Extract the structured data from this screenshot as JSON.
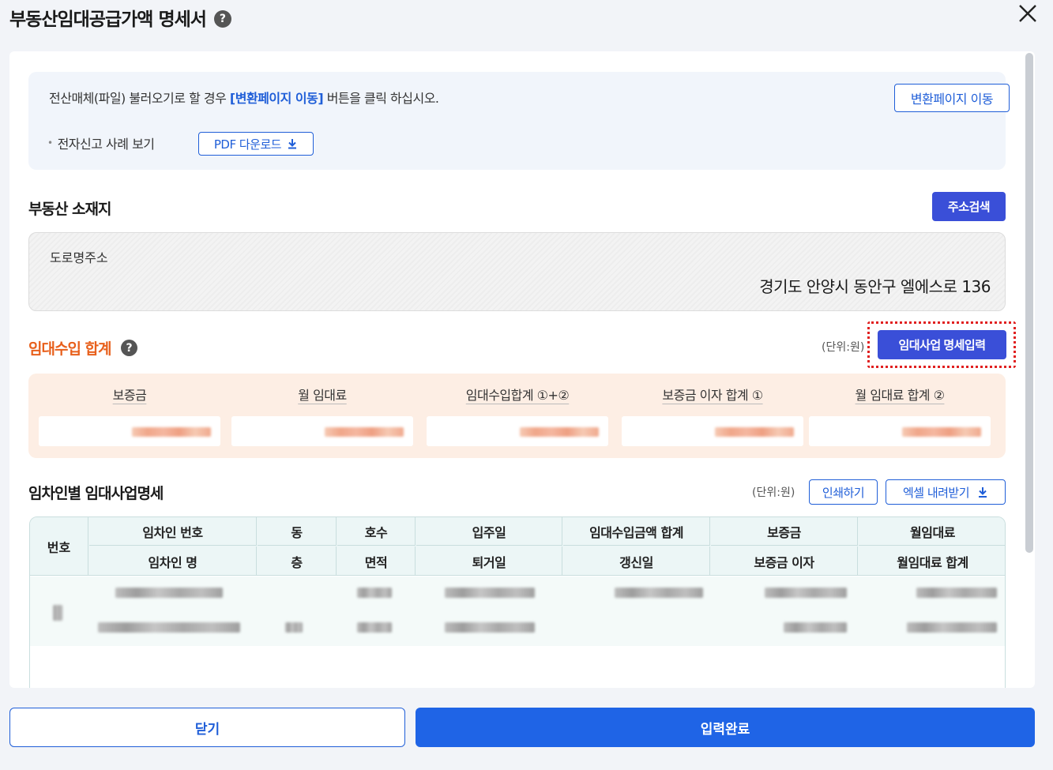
{
  "header": {
    "title": "부동산임대공급가액 명세서",
    "help": "?",
    "close": "×"
  },
  "info": {
    "text_before": "전산매체(파일) 불러오기로 할 경우 ",
    "text_highlight": "[변환페이지 이동]",
    "text_after": " 버튼을 클릭 하십시오.",
    "convert_button": "변환페이지 이동",
    "example_label": "전자신고 사례 보기",
    "pdf_button": "PDF 다운로드"
  },
  "location": {
    "title": "부동산 소재지",
    "search_button": "주소검색",
    "road_label": "도로명주소",
    "road_value": "경기도 안양시 동안구 엘에스로 136"
  },
  "income": {
    "title": "임대수입 합계",
    "help": "?",
    "unit": "(단위:원)",
    "lease_button": "임대사업 명세입력",
    "columns": [
      "보증금",
      "월 임대료",
      "임대수입합계 ①+②",
      "보증금 이자 합계 ①",
      "월 임대료 합계 ②"
    ]
  },
  "tenant": {
    "title": "임차인별 임대사업명세",
    "unit": "(단위:원)",
    "print_button": "인쇄하기",
    "excel_button": "엑셀 내려받기",
    "head_no": "번호",
    "head_row1": [
      "임차인 번호",
      "동",
      "호수",
      "입주일",
      "임대수입금액 합계",
      "보증금",
      "월임대료"
    ],
    "head_row2": [
      "임차인 명",
      "층",
      "면적",
      "퇴거일",
      "갱신일",
      "보증금 이자",
      "월임대료 합계"
    ]
  },
  "footer": {
    "close_button": "닫기",
    "done_button": "입력완료"
  }
}
